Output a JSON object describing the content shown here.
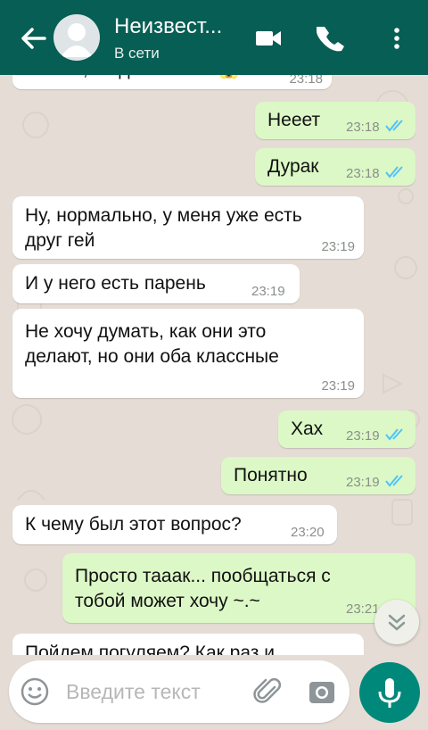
{
  "header": {
    "contact_name": "Неизвест...",
    "status": "В сети"
  },
  "messages": [
    {
      "dir": "in",
      "text": "Ты что, по девочкам? 😱",
      "time": "23:18"
    },
    {
      "dir": "out",
      "text": "Нееет",
      "time": "23:18",
      "read": true
    },
    {
      "dir": "out",
      "text": "Дурак",
      "time": "23:18",
      "read": true
    },
    {
      "dir": "in",
      "lines": [
        "Ну, нормально, у меня уже есть",
        "друг гей"
      ],
      "time": "23:19"
    },
    {
      "dir": "in",
      "text": "И у него есть парень",
      "time": "23:19"
    },
    {
      "dir": "in",
      "lines": [
        "Не хочу думать, как они это",
        "делают, но они оба классные"
      ],
      "time": "23:19"
    },
    {
      "dir": "out",
      "text": "Хах",
      "time": "23:19",
      "read": true
    },
    {
      "dir": "out",
      "text": "Понятно",
      "time": "23:19",
      "read": true
    },
    {
      "dir": "in",
      "text": "К чему был этот вопрос?",
      "time": "23:20"
    },
    {
      "dir": "out",
      "lines": [
        "Просто тааак... пообщаться с",
        "тобой может хочу ~.~"
      ],
      "time": "23:21"
    },
    {
      "dir": "in",
      "text": "Пойдем погуляем? Как раз и"
    }
  ],
  "composer": {
    "placeholder": "Введите текст"
  },
  "colors": {
    "header": "#075e54",
    "outgoing_bubble": "#dcf8c6",
    "incoming_bubble": "#ffffff",
    "chat_background": "#e5ddd5",
    "read_ticks": "#4fc3f7",
    "mic_button": "#00897b"
  },
  "icons": [
    "back-arrow-icon",
    "avatar-placeholder-icon",
    "video-call-icon",
    "phone-call-icon",
    "more-vert-icon",
    "double-check-icon",
    "scroll-down-icon",
    "emoji-icon",
    "attach-icon",
    "camera-icon",
    "mic-icon"
  ]
}
